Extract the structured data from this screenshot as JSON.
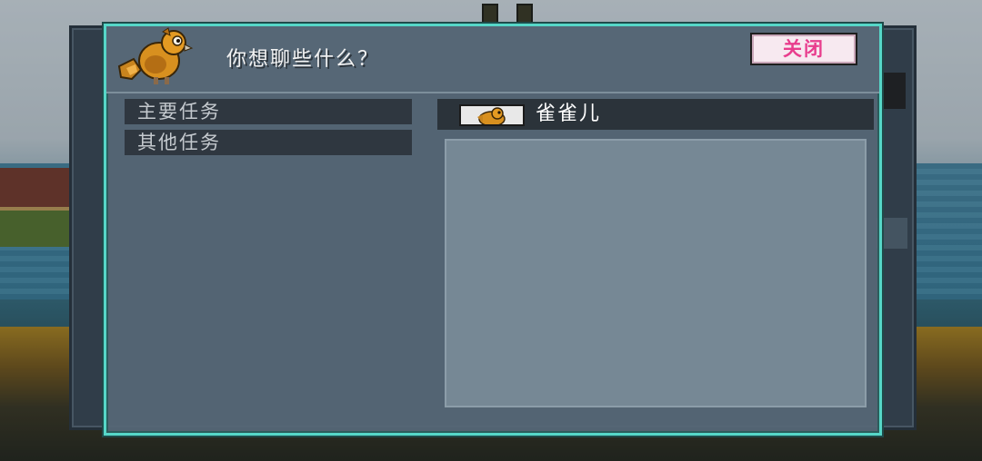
{
  "dialog": {
    "title": "你想聊些什么？",
    "close_label": "关闭",
    "portrait_icon": "bird-portrait-icon"
  },
  "tasks": [
    {
      "label": "主要任务"
    },
    {
      "label": "其他任务"
    }
  ],
  "npc": {
    "name": "雀雀儿",
    "icon": "bird-thumbnail-icon"
  },
  "colors": {
    "border_accent": "#56d7c8",
    "close_text": "#e83d8d",
    "panel": "#566776"
  }
}
